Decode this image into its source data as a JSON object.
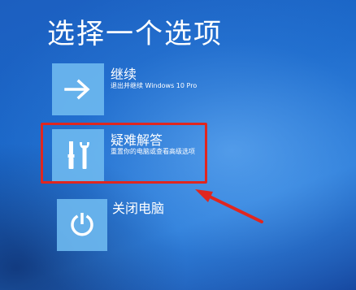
{
  "screen": {
    "title": "选择一个选项"
  },
  "options": [
    {
      "label": "继续",
      "subtitle": "退出并继续 Windows 10 Pro",
      "icon": "arrow-right-icon"
    },
    {
      "label": "疑难解答",
      "subtitle": "重置你的电脑或查看高级选项",
      "icon": "tools-icon"
    },
    {
      "label": "关闭电脑",
      "subtitle": "",
      "icon": "power-icon"
    }
  ],
  "annotation": {
    "highlight_color": "#e0261f",
    "highlighted_option": "疑难解答"
  },
  "colors": {
    "background": "#1a67c8",
    "tile": "#6eb9f0",
    "text": "#ffffff"
  }
}
